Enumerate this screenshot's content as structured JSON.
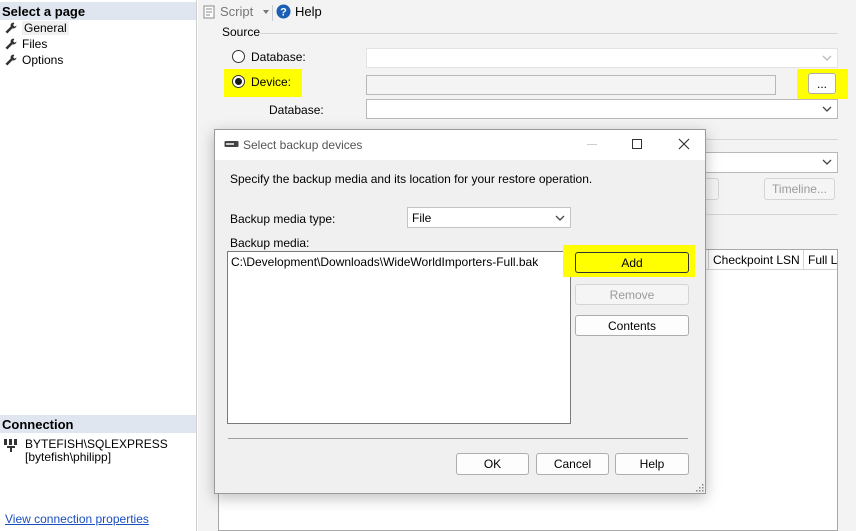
{
  "left_panel": {
    "select_page_header": "Select a page",
    "pages": [
      {
        "label": "General",
        "selected": true
      },
      {
        "label": "Files",
        "selected": false
      },
      {
        "label": "Options",
        "selected": false
      }
    ],
    "connection_header": "Connection",
    "connection": {
      "server": "BYTEFISH\\SQLEXPRESS",
      "user": "[bytefish\\philipp]"
    },
    "view_connection_link": "View connection properties"
  },
  "toolbar": {
    "script_label": "Script",
    "help_label": "Help"
  },
  "source": {
    "group_label": "Source",
    "database_radio_label": "Database:",
    "device_radio_label": "Device:",
    "device_browse_label": "...",
    "device_database_label": "Database:",
    "selected_option": "Device"
  },
  "background": {
    "timeline_button": "Timeline...",
    "grid_headers": [
      "Checkpoint LSN",
      "Full LS"
    ]
  },
  "dialog": {
    "title": "Select backup devices",
    "instructions": "Specify the backup media and its location for your restore operation.",
    "media_type_label": "Backup media type:",
    "media_type_value": "File",
    "backup_media_label": "Backup media:",
    "backup_media_items": [
      "C:\\Development\\Downloads\\WideWorldImporters-Full.bak"
    ],
    "add_button": "Add",
    "remove_button": "Remove",
    "contents_button": "Contents",
    "ok_button": "OK",
    "cancel_button": "Cancel",
    "help_button": "Help"
  },
  "colors": {
    "highlight": "#ffff00",
    "panel_header_bg": "#dfe6f0",
    "link": "#1a4fbf"
  }
}
